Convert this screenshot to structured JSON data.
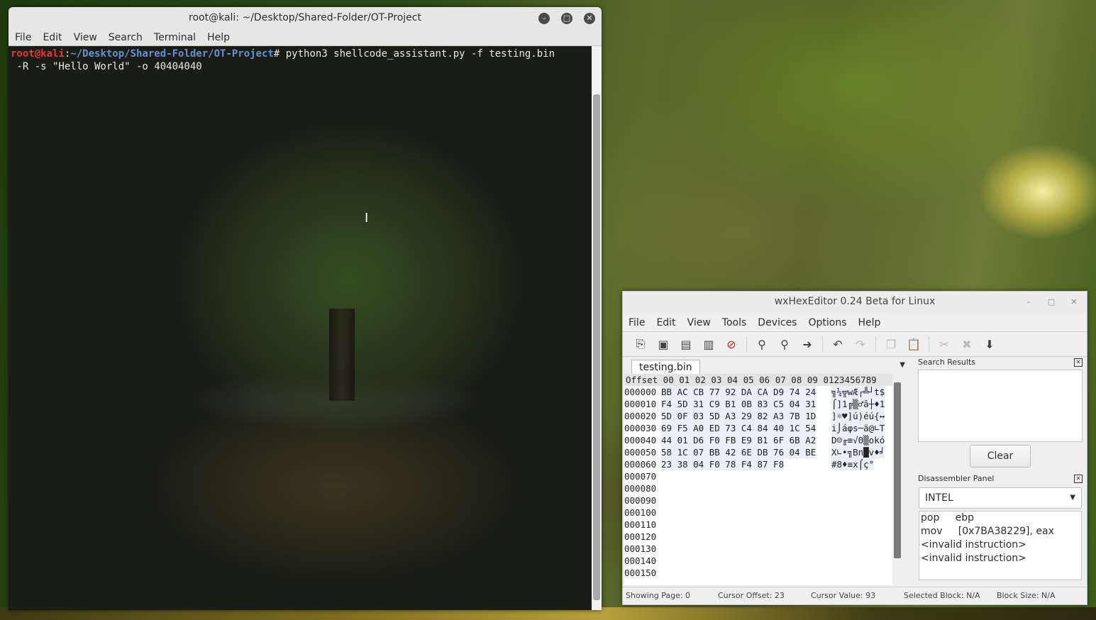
{
  "terminal": {
    "title": "root@kali: ~/Desktop/Shared-Folder/OT-Project",
    "menu": [
      "File",
      "Edit",
      "View",
      "Search",
      "Terminal",
      "Help"
    ],
    "prompt_user": "root@kali",
    "prompt_colon": ":",
    "prompt_path": "~/Desktop/Shared-Folder/OT-Project",
    "prompt_symbol": "#",
    "command_line1": " python3 shellcode_assistant.py -f testing.bin",
    "command_line2": " -R -s \"Hello World\" -o 40404040"
  },
  "hexeditor": {
    "title": "wxHexEditor 0.24 Beta for Linux",
    "menu": [
      "File",
      "Edit",
      "View",
      "Tools",
      "Devices",
      "Options",
      "Help"
    ],
    "tab": "testing.bin",
    "grid_header": "Offset 00 01 02 03 04 05 06 07 08 09 0123456789",
    "rows": [
      {
        "offset": "000000",
        "hex": "BB AC CB 77 92 DA CA D9 74 24",
        "ascii": "╗¼╦wÆ┌╩┘t$"
      },
      {
        "offset": "000010",
        "hex": "F4 5D 31 C9 B1 0B 83 C5 04 31",
        "ascii": "⌠]1╔▒♂â┼♦1"
      },
      {
        "offset": "000020",
        "hex": "5D 0F 03 5D A3 29 82 A3 7B 1D",
        "ascii": "]☼♥]ú)éú{↔"
      },
      {
        "offset": "000030",
        "hex": "69 F5 A0 ED 73 C4 84 40 1C 54",
        "ascii": "i⌡áφs─ä@∟T"
      },
      {
        "offset": "000040",
        "hex": "44 01 D6 F0 FB E9 B1 6F 6B A2",
        "ascii": "D☺╓≡√Θ▒okó"
      },
      {
        "offset": "000050",
        "hex": "58 1C 07 BB 42 6E DB 76 04 BE",
        "ascii": "X∟•╗Bn█v♦╛"
      },
      {
        "offset": "000060",
        "hex": "23 38 04 F0 78 F4 87 F8",
        "ascii": "#8♦≡x⌠ç°"
      },
      {
        "offset": "000070",
        "hex": "",
        "ascii": ""
      },
      {
        "offset": "000080",
        "hex": "",
        "ascii": ""
      },
      {
        "offset": "000090",
        "hex": "",
        "ascii": ""
      },
      {
        "offset": "000100",
        "hex": "",
        "ascii": ""
      },
      {
        "offset": "000110",
        "hex": "",
        "ascii": ""
      },
      {
        "offset": "000120",
        "hex": "",
        "ascii": ""
      },
      {
        "offset": "000130",
        "hex": "",
        "ascii": ""
      },
      {
        "offset": "000140",
        "hex": "",
        "ascii": ""
      },
      {
        "offset": "000150",
        "hex": "",
        "ascii": ""
      }
    ],
    "search_panel": {
      "title": "Search Results",
      "clear_label": "Clear"
    },
    "disasm_panel": {
      "title": "Disassembler Panel",
      "arch": "INTEL",
      "lines": [
        "pop     ebp",
        "mov     [0x7BA38229], eax",
        "<invalid instruction>",
        "<invalid instruction>"
      ]
    },
    "status": {
      "page": "Showing Page: 0",
      "cursor_offset": "Cursor Offset: 23",
      "cursor_value": "Cursor Value: 93",
      "selected_block": "Selected Block: N/A",
      "block_size": "Block Size: N/A"
    }
  }
}
